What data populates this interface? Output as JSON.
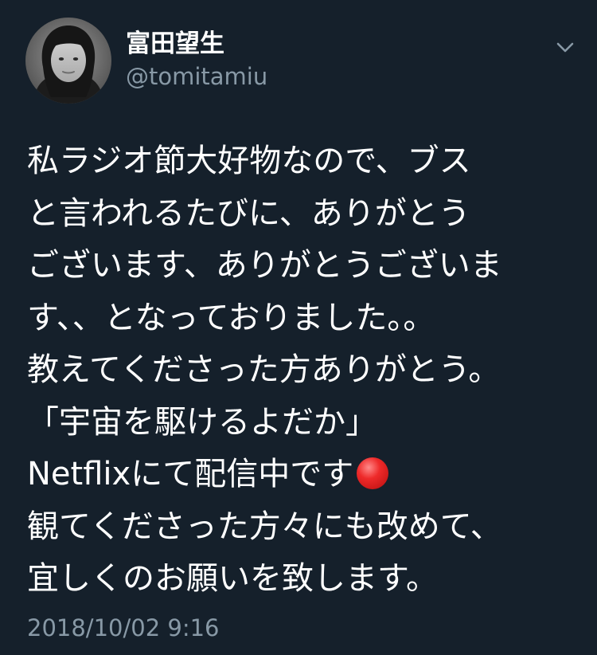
{
  "tweet": {
    "display_name": "富田望生",
    "handle": "@tomitamiu",
    "body_lines": [
      "私ラジオ節大好物なので、ブス",
      "と言われるたびに、ありがとう",
      "ございます、ありがとうございま",
      "す、、となっておりました。。",
      "教えてくださった方ありがとう。",
      "「宇宙を駆けるよだか」",
      "Netflixにて配信中です",
      "観てくださった方々にも改めて、",
      "宜しくのお願いを致します。"
    ],
    "emoji": "red-circle",
    "timestamp": "2018/10/02 9:16"
  },
  "icons": {
    "menu": "chevron-down-icon",
    "avatar": "profile-photo"
  },
  "colors": {
    "background": "#15202b",
    "primary_text": "#ffffff",
    "secondary_text": "#8899a6",
    "emoji_red": "#e82727"
  }
}
